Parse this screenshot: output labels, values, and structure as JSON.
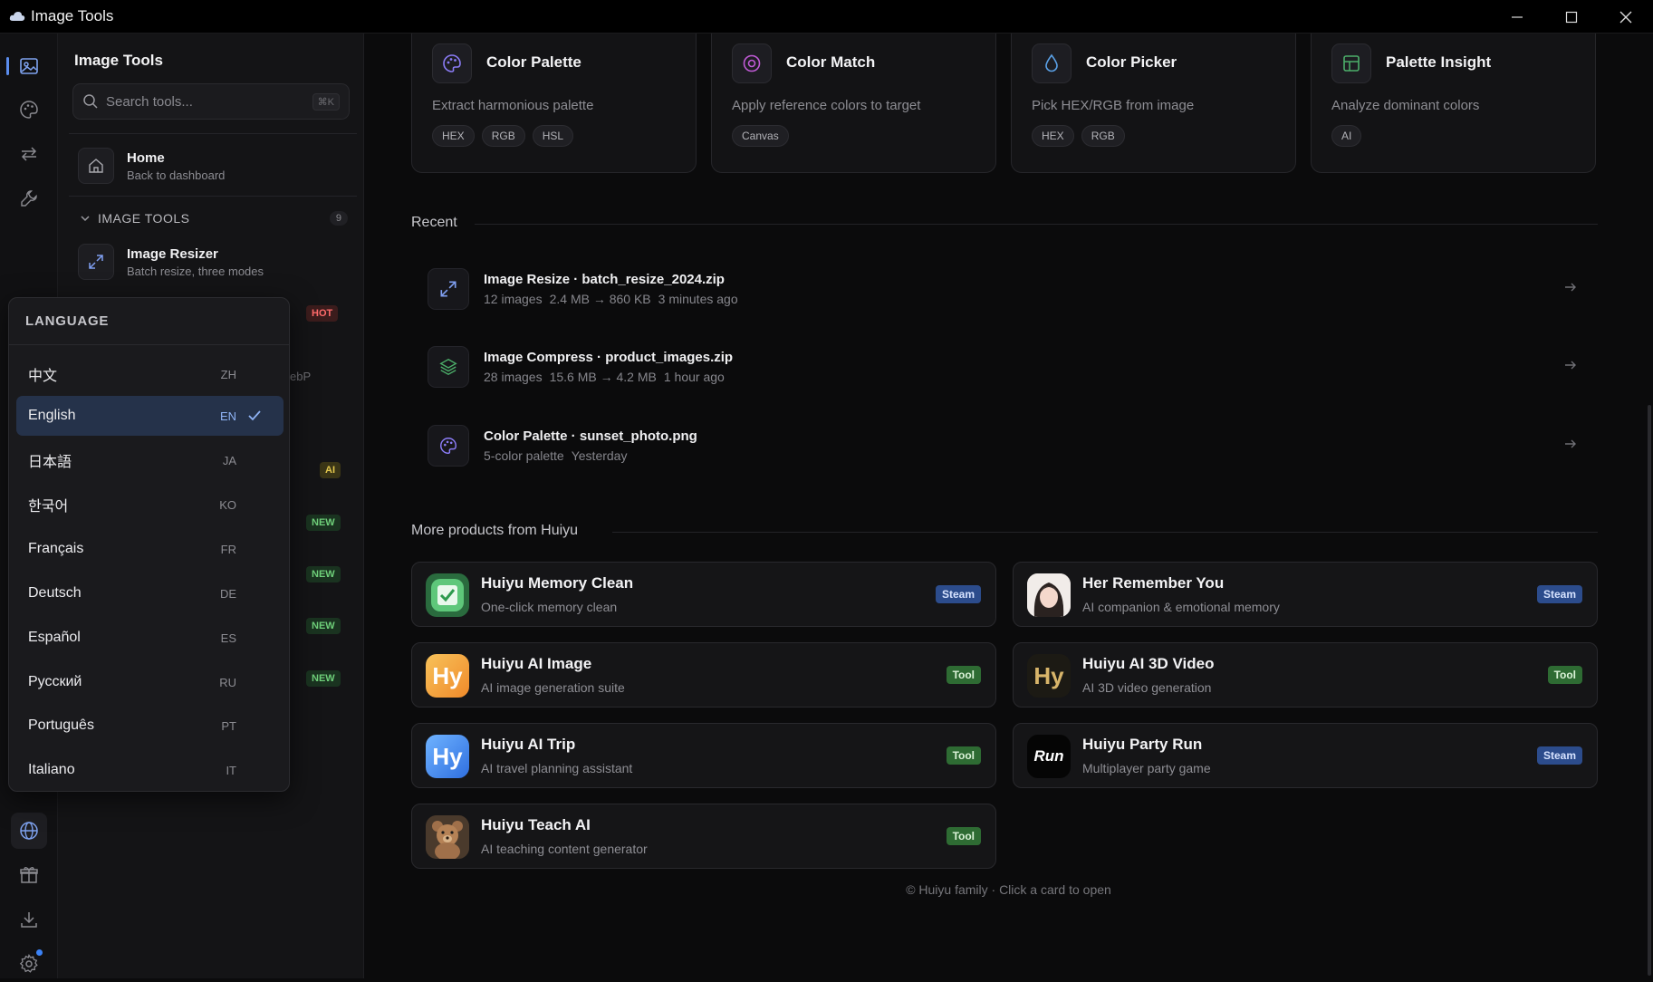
{
  "window": {
    "title": "Image Tools"
  },
  "rail": {
    "top": [
      "image-icon",
      "palette-icon",
      "convert-icon",
      "wrench-icon"
    ],
    "bottom": [
      "globe-icon",
      "gift-icon",
      "download-icon",
      "gear-icon"
    ]
  },
  "sidebar": {
    "title": "Image Tools",
    "search_placeholder": "Search tools...",
    "search_shortcut": "⌘K",
    "home": {
      "label": "Home",
      "sub": "Back to dashboard"
    },
    "section": {
      "label": "IMAGE TOOLS",
      "count": "9"
    },
    "resizer": {
      "label": "Image Resizer",
      "sub": "Batch resize, three modes"
    },
    "tags": [
      "HOT",
      "AI",
      "NEW",
      "NEW",
      "NEW",
      "NEW"
    ],
    "peek_text": "ebP"
  },
  "language": {
    "header": "LANGUAGE",
    "options": [
      {
        "name": "中文",
        "code": "ZH"
      },
      {
        "name": "English",
        "code": "EN",
        "selected": true
      },
      {
        "name": "日本語",
        "code": "JA"
      },
      {
        "name": "한국어",
        "code": "KO"
      },
      {
        "name": "Français",
        "code": "FR"
      },
      {
        "name": "Deutsch",
        "code": "DE"
      },
      {
        "name": "Español",
        "code": "ES"
      },
      {
        "name": "Русский",
        "code": "RU"
      },
      {
        "name": "Português",
        "code": "PT"
      },
      {
        "name": "Italiano",
        "code": "IT"
      }
    ]
  },
  "tool_cards": [
    {
      "name": "Color Palette",
      "desc": "Extract harmonious palette",
      "chips": [
        "HEX",
        "RGB",
        "HSL"
      ],
      "icon": "palette-icon",
      "accent": "#8b7cf6"
    },
    {
      "name": "Color Match",
      "desc": "Apply reference colors to target",
      "chips": [
        "Canvas"
      ],
      "icon": "target-icon",
      "accent": "#c05ad6"
    },
    {
      "name": "Color Picker",
      "desc": "Pick HEX/RGB from image",
      "chips": [
        "HEX",
        "RGB"
      ],
      "icon": "droplet-icon",
      "accent": "#5aa0e6"
    },
    {
      "name": "Palette Insight",
      "desc": "Analyze dominant colors",
      "chips": [
        "AI"
      ],
      "icon": "grid-icon",
      "accent": "#4caf6a"
    }
  ],
  "recent": {
    "title": "Recent",
    "items": [
      {
        "title": "Image Resize · batch_resize_2024.zip",
        "meta": [
          "12 images",
          "2.4 MB → 860 KB",
          "3 minutes ago"
        ],
        "icon": "resize-icon",
        "accent": "#7f9ff0"
      },
      {
        "title": "Image Compress · product_images.zip",
        "meta": [
          "28 images",
          "15.6 MB → 4.2 MB",
          "1 hour ago"
        ],
        "icon": "layers-icon",
        "accent": "#4caf6a"
      },
      {
        "title": "Color Palette · sunset_photo.png",
        "meta": [
          "5-color palette",
          "Yesterday"
        ],
        "icon": "palette-icon",
        "accent": "#8b7cf6"
      }
    ]
  },
  "products": {
    "title": "More products from Huiyu",
    "items": [
      {
        "name": "Huiyu Memory Clean",
        "desc": "One-click memory clean",
        "badge": "Steam",
        "logo": "memory-clean-logo"
      },
      {
        "name": "Her Remember You",
        "desc": "AI companion & emotional memory",
        "badge": "Steam",
        "logo": "portrait-logo"
      },
      {
        "name": "Huiyu AI Image",
        "desc": "AI image generation suite",
        "badge": "Tool",
        "logo": "hy-orange-logo",
        "logo_text": "Hy"
      },
      {
        "name": "Huiyu AI 3D Video",
        "desc": "AI 3D video generation",
        "badge": "Tool",
        "logo": "hy-gold-logo",
        "logo_text": "Hy"
      },
      {
        "name": "Huiyu AI Trip",
        "desc": "AI travel planning assistant",
        "badge": "Tool",
        "logo": "hy-blue-logo",
        "logo_text": "Hy"
      },
      {
        "name": "Huiyu Party Run",
        "desc": "Multiplayer party game",
        "badge": "Steam",
        "logo": "run-logo",
        "logo_text": "Run"
      },
      {
        "name": "Huiyu Teach AI",
        "desc": "AI teaching content generator",
        "badge": "Tool",
        "logo": "teddy-bear-logo"
      }
    ]
  },
  "footer": "© Huiyu family · Click a card to open"
}
